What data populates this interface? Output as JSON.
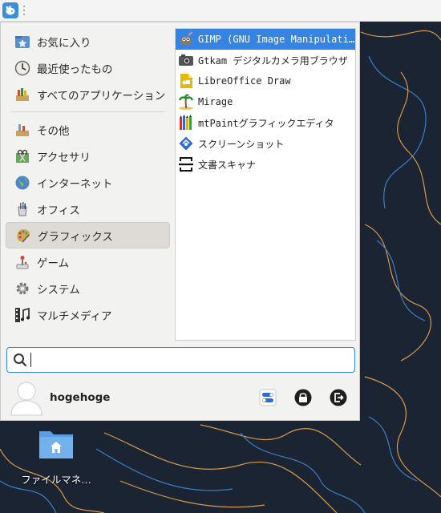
{
  "panel": {
    "menu_button_icon": "xfce-mouse-icon"
  },
  "categories": [
    {
      "label": "お気に入り",
      "icon": "favorites-icon"
    },
    {
      "label": "最近使ったもの",
      "icon": "recent-clock-icon"
    },
    {
      "label": "すべてのアプリケーション",
      "icon": "all-apps-icon"
    },
    {
      "label": "その他",
      "icon": "other-icon"
    },
    {
      "label": "アクセサリ",
      "icon": "accessories-icon"
    },
    {
      "label": "インターネット",
      "icon": "internet-globe-icon"
    },
    {
      "label": "オフィス",
      "icon": "office-icon"
    },
    {
      "label": "グラフィックス",
      "icon": "graphics-palette-icon",
      "active": true
    },
    {
      "label": "ゲーム",
      "icon": "games-icon"
    },
    {
      "label": "システム",
      "icon": "system-gear-icon"
    },
    {
      "label": "マルチメディア",
      "icon": "multimedia-icon"
    }
  ],
  "apps": [
    {
      "label": "GIMP (GNU Image Manipulation Program)",
      "icon": "gimp-icon",
      "selected": true
    },
    {
      "label": "Gtkam デジタルカメラ用ブラウザ",
      "icon": "camera-icon"
    },
    {
      "label": "LibreOffice Draw",
      "icon": "libreoffice-draw-icon"
    },
    {
      "label": "Mirage",
      "icon": "mirage-palm-icon"
    },
    {
      "label": "mtPaintグラフィックエディタ",
      "icon": "mtpaint-pencils-icon"
    },
    {
      "label": "スクリーンショット",
      "icon": "screenshot-icon"
    },
    {
      "label": "文書スキャナ",
      "icon": "scanner-icon"
    }
  ],
  "search": {
    "value": "",
    "icon": "search-icon"
  },
  "user": {
    "name": "hogehoge",
    "avatar_icon": "user-avatar-icon",
    "buttons": [
      {
        "icon": "settings-toggle-icon"
      },
      {
        "icon": "lock-icon"
      },
      {
        "icon": "logout-icon"
      }
    ]
  },
  "desktop": {
    "icons": [
      {
        "label": "ファイルマネ…",
        "icon": "home-folder-icon"
      }
    ]
  },
  "colors": {
    "accent": "#3584e4",
    "desktop": "#1b2433"
  }
}
